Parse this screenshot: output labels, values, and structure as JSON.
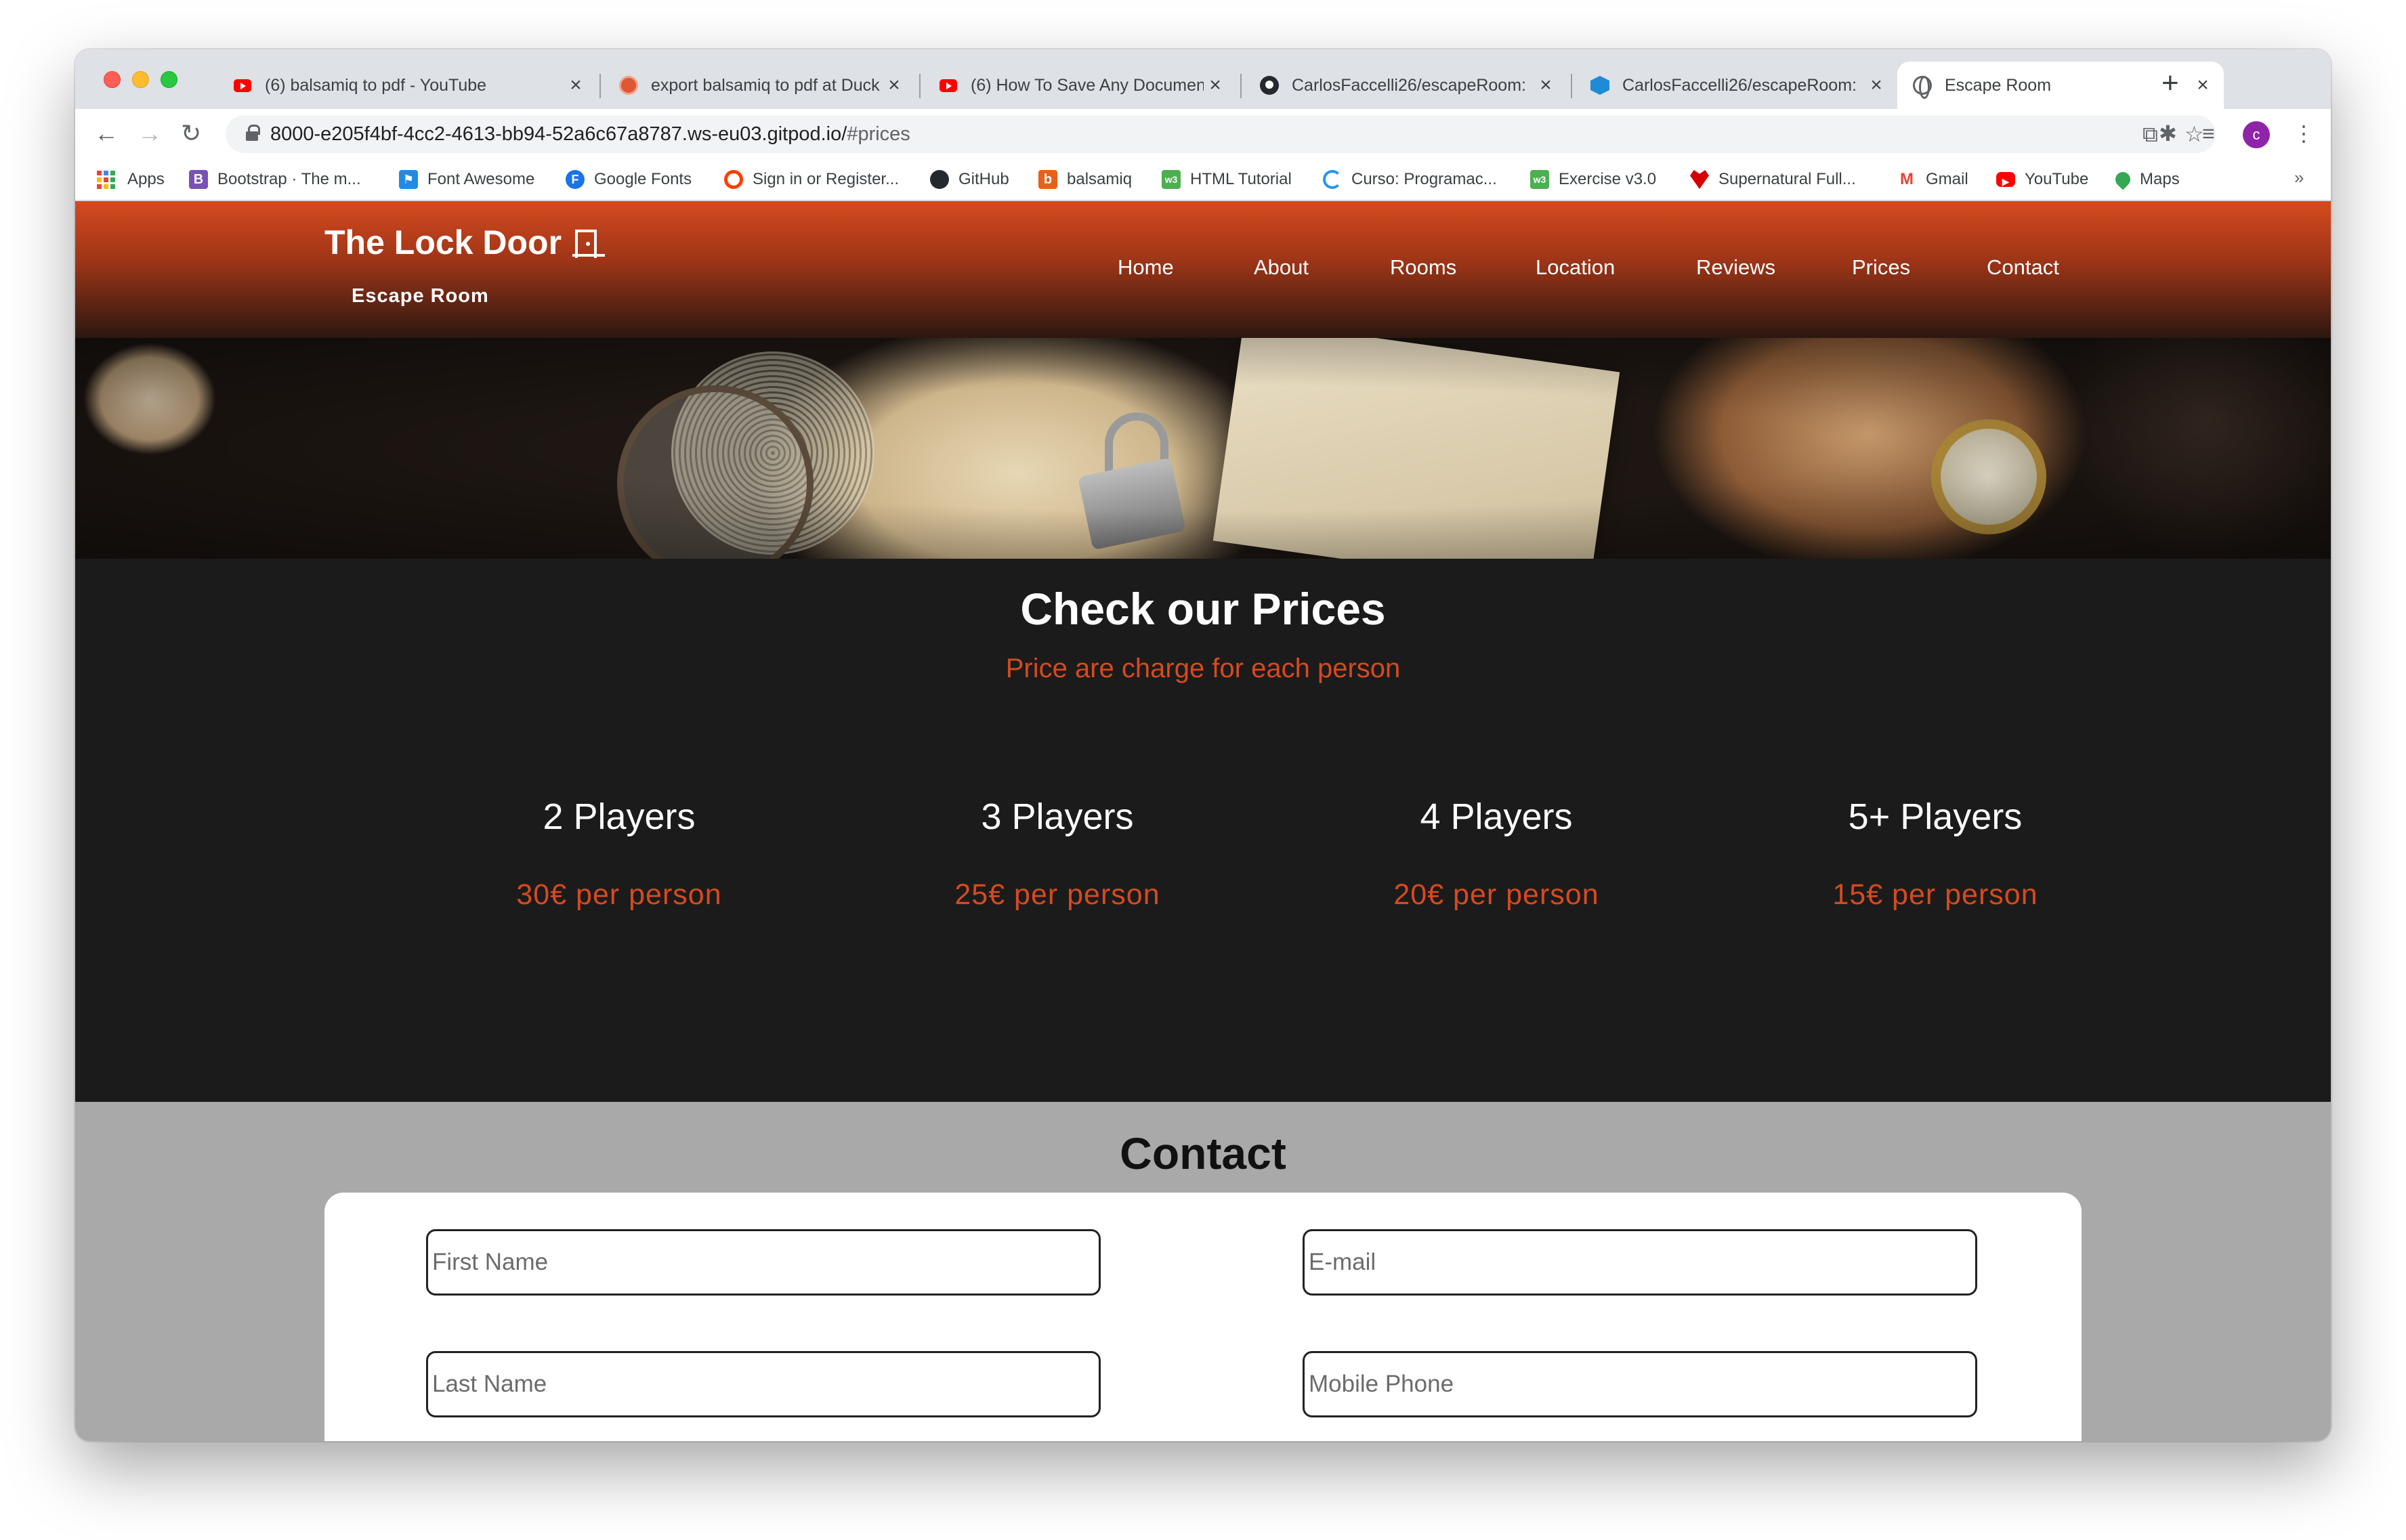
{
  "browser": {
    "tabs": [
      {
        "title": "(6) balsamiq to pdf - YouTube",
        "icon": "youtube-icon",
        "close": "×"
      },
      {
        "title": "export balsamiq to pdf at Duck",
        "icon": "duckduckgo-icon",
        "close": "×"
      },
      {
        "title": "(6) How To Save Any Documen",
        "icon": "youtube-icon",
        "close": "×"
      },
      {
        "title": "CarlosFaccelli26/escapeRoom:",
        "icon": "github-icon",
        "close": "×"
      },
      {
        "title": "CarlosFaccelli26/escapeRoom:",
        "icon": "gitpod-icon",
        "close": "×"
      },
      {
        "title": "Escape Room",
        "icon": "globe-icon",
        "close": "×",
        "active": true
      }
    ],
    "new_tab": "+",
    "nav": {
      "back": "←",
      "forward": "→",
      "reload": "↻"
    },
    "url": {
      "host": "8000-e205f4bf-4cc2-4613-bb94-52a6c67a8787.ws-eu03.gitpod.io/",
      "path": "#prices"
    },
    "omnibox_icons": {
      "translate": "⧉",
      "star": "☆"
    },
    "toolbar_icons": {
      "extensions": "✱",
      "reading_list": "≡",
      "menu": "⋮"
    },
    "profile_initial": "c",
    "bookmarks": [
      {
        "label": "Apps",
        "icon": "apps-grid-icon"
      },
      {
        "label": "Bootstrap · The m...",
        "icon": "bootstrap-icon",
        "color": "#7952b3",
        "glyph": "B"
      },
      {
        "label": "Font Awesome",
        "icon": "font-awesome-icon",
        "color": "#228ae6",
        "glyph": "⚑"
      },
      {
        "label": "Google Fonts",
        "icon": "google-fonts-icon",
        "color": "#1a73e8",
        "glyph": "F"
      },
      {
        "label": "Sign in or Register...",
        "icon": "register-icon",
        "color": "#ff3d00",
        "glyph": "○"
      },
      {
        "label": "GitHub",
        "icon": "github-icon",
        "color": "#24292f",
        "glyph": "●"
      },
      {
        "label": "balsamiq",
        "icon": "balsamiq-icon",
        "color": "#e5611c",
        "glyph": "b"
      },
      {
        "label": "HTML Tutorial",
        "icon": "w3schools-icon",
        "color": "#4caf50",
        "glyph": "w3"
      },
      {
        "label": "Curso: Programac...",
        "icon": "course-icon",
        "color": "#2196f3",
        "glyph": "◌"
      },
      {
        "label": "Exercise v3.0",
        "icon": "w3schools-exercise-icon",
        "color": "#4caf50",
        "glyph": "w3"
      },
      {
        "label": "Supernatural Full...",
        "icon": "supernatural-icon",
        "color": "#d50000",
        "glyph": "♥"
      },
      {
        "label": "Gmail",
        "icon": "gmail-icon",
        "color": "#ea4335",
        "glyph": "M"
      },
      {
        "label": "YouTube",
        "icon": "youtube-icon",
        "color": "#ff0000",
        "glyph": "▶"
      },
      {
        "label": "Maps",
        "icon": "maps-icon",
        "color": "#34a853",
        "glyph": "◉"
      }
    ],
    "bookmarks_more": "»"
  },
  "site": {
    "brand_title": "The Lock Door",
    "brand_subtitle": "Escape Room",
    "nav": [
      "Home",
      "About",
      "Rooms",
      "Location",
      "Reviews",
      "Prices",
      "Contact"
    ],
    "accent_color": "#d64a1f"
  },
  "prices": {
    "title": "Check our Prices",
    "subtitle": "Price are charge for each person",
    "plans": [
      {
        "players": "2 Players",
        "price": "30€ per person"
      },
      {
        "players": "3 Players",
        "price": "25€ per person"
      },
      {
        "players": "4 Players",
        "price": "20€ per person"
      },
      {
        "players": "5+ Players",
        "price": "15€ per person"
      }
    ]
  },
  "contact": {
    "title": "Contact",
    "fields": {
      "first_name": "First Name",
      "email": "E-mail",
      "last_name": "Last Name",
      "mobile": "Mobile Phone"
    }
  }
}
